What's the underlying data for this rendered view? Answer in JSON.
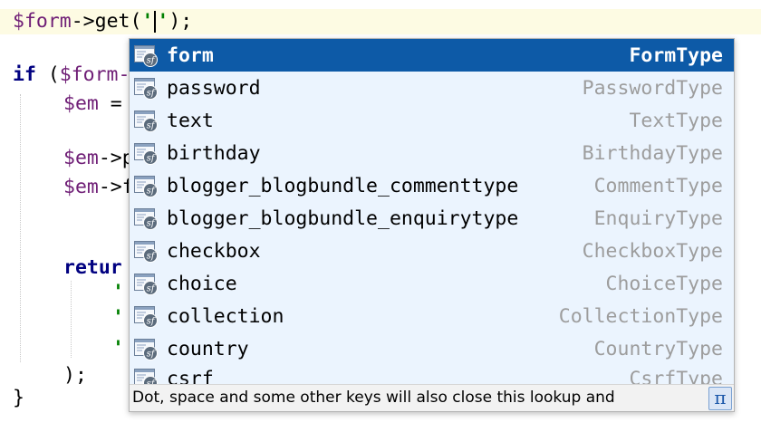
{
  "editor": {
    "current_line": {
      "var": "$form",
      "op": "->get(",
      "str_open": "'",
      "str_close": "'",
      "end": ");"
    },
    "line_if": {
      "kw": "if",
      "rest": " (",
      "var": "$form-"
    },
    "line_em": {
      "var": "$em",
      "rest": " ="
    },
    "line_em_p": {
      "var": "$em",
      "rest": "->p"
    },
    "line_em_f": {
      "var": "$em",
      "rest": "->f"
    },
    "line_return": {
      "kw": "retur"
    },
    "line_str1": "'",
    "line_str2": "'",
    "line_str3": "'",
    "line_close_call": ");",
    "line_close_brace": "}"
  },
  "lookup": {
    "items": [
      {
        "name": "form",
        "type": "FormType",
        "selected": true
      },
      {
        "name": "password",
        "type": "PasswordType"
      },
      {
        "name": "text",
        "type": "TextType"
      },
      {
        "name": "birthday",
        "type": "BirthdayType"
      },
      {
        "name": "blogger_blogbundle_commenttype",
        "type": "CommentType"
      },
      {
        "name": "blogger_blogbundle_enquirytype",
        "type": "EnquiryType"
      },
      {
        "name": "checkbox",
        "type": "CheckboxType"
      },
      {
        "name": "choice",
        "type": "ChoiceType"
      },
      {
        "name": "collection",
        "type": "CollectionType"
      },
      {
        "name": "country",
        "type": "CountryType"
      },
      {
        "name": "csrf",
        "type": "CsrfType"
      }
    ],
    "hint": "Dot, space and some other keys will also close this lookup and",
    "pi_label": "π",
    "icon": "symfony-form-type-icon"
  },
  "colors": {
    "selection": "#0d5aa7",
    "popup_bg": "#ebf4fe",
    "current_line": "#fdfbe3",
    "variable": "#6f1e76",
    "keyword": "#000080",
    "string": "#008000"
  }
}
